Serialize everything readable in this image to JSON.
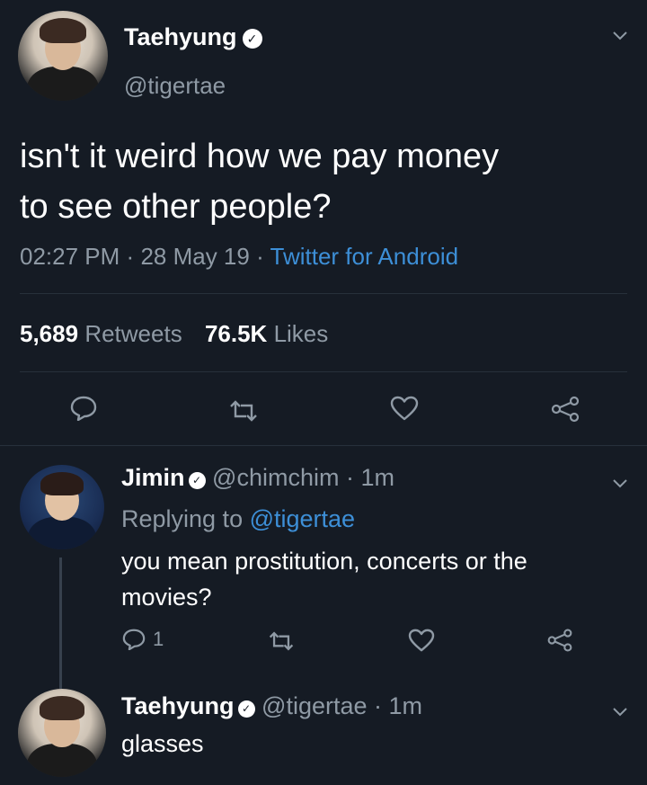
{
  "main_tweet": {
    "display_name": "Taehyung",
    "handle": "@tigertae",
    "text_line1": "isn't it weird how we pay money",
    "text_line2": "to see other people?",
    "time": "02:27 PM",
    "date": "28 May 19",
    "source": "Twitter for Android",
    "retweets_count": "5,689",
    "retweets_label": "Retweets",
    "likes_count": "76.5K",
    "likes_label": "Likes"
  },
  "reply1": {
    "display_name": "Jimin",
    "handle": "@chimchim",
    "age": "1m",
    "replying_to_label": "Replying to",
    "replying_to_handle": "@tigertae",
    "text_line1": "you mean prostitution, concerts or the",
    "text_line2": "movies?",
    "reply_count": "1"
  },
  "reply2": {
    "display_name": "Taehyung",
    "handle": "@tigertae",
    "age": "1m",
    "text": "glasses"
  },
  "separator": "·",
  "icons": {
    "verified": "verified-badge-icon",
    "chevron": "chevron-down-icon",
    "reply": "reply-icon",
    "retweet": "retweet-icon",
    "like": "heart-icon",
    "share": "share-icon"
  },
  "colors": {
    "background": "#151b24",
    "text": "#ffffff",
    "muted": "#8f9aa5",
    "link": "#3d8fd7"
  }
}
